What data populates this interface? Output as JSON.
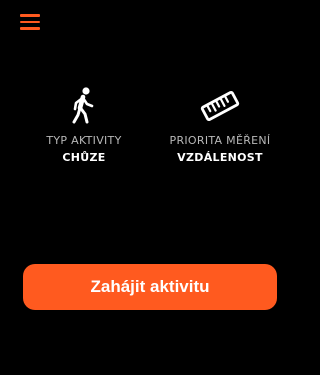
{
  "header": {
    "menu_icon": "hamburger-menu-icon"
  },
  "options": [
    {
      "icon": "walking-person-icon",
      "label": "TYP AKTIVITY",
      "value": "CHŮZE"
    },
    {
      "icon": "ruler-icon",
      "label": "PRIORITA MĚŘENÍ",
      "value": "VZDÁLENOST"
    }
  ],
  "start_button": {
    "label": "Zahájit aktivitu"
  },
  "colors": {
    "accent": "#ff5a1f",
    "background": "#000000",
    "label_text": "#b8b8b8",
    "value_text": "#ffffff"
  }
}
